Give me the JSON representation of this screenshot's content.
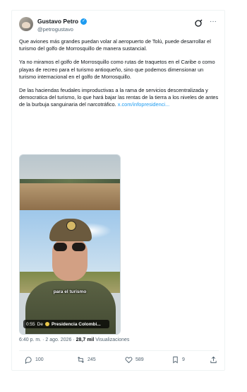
{
  "author": {
    "name": "Gustavo Petro",
    "handle": "@petrogustavo",
    "verified": true
  },
  "tweet": {
    "paragraphs": [
      "Que aviones más grandes puedan volar al aeropuerto de Tolú, puede desarrollar el turismo del golfo de Morrosquillo de manera sustancial.",
      "Ya no miramos el golfo de Morrosquillo como rutas de traquetos en el Caribe o como playas de recreo para el turismo antioqueño, sino que podemos dimensionar un turismo internacional en el golfo de Morrosquillo.",
      "De las haciendas feudales improductivas a la rama de servicios descentralizada y democratica del turismo, lo que hará bajar las rentas de la tierra a los niveles de antes de la burbuja sanguinaria del narcotráfico."
    ],
    "link_text": "x.com/infopresidenci..."
  },
  "media": {
    "caption": "para el turismo",
    "duration": "0:55",
    "from_label": "De",
    "source": "Presidencia Colombi..."
  },
  "meta": {
    "time": "6:40 p. m.",
    "separator": "·",
    "date": "2 ago. 2026",
    "views_count": "28,7 mil",
    "views_label": "Visualizaciones"
  },
  "actions": {
    "replies": "100",
    "reposts": "245",
    "likes": "589",
    "bookmarks": "9"
  },
  "colors": {
    "accent": "#1d9bf0",
    "text": "#0f1419",
    "muted": "#536471"
  }
}
